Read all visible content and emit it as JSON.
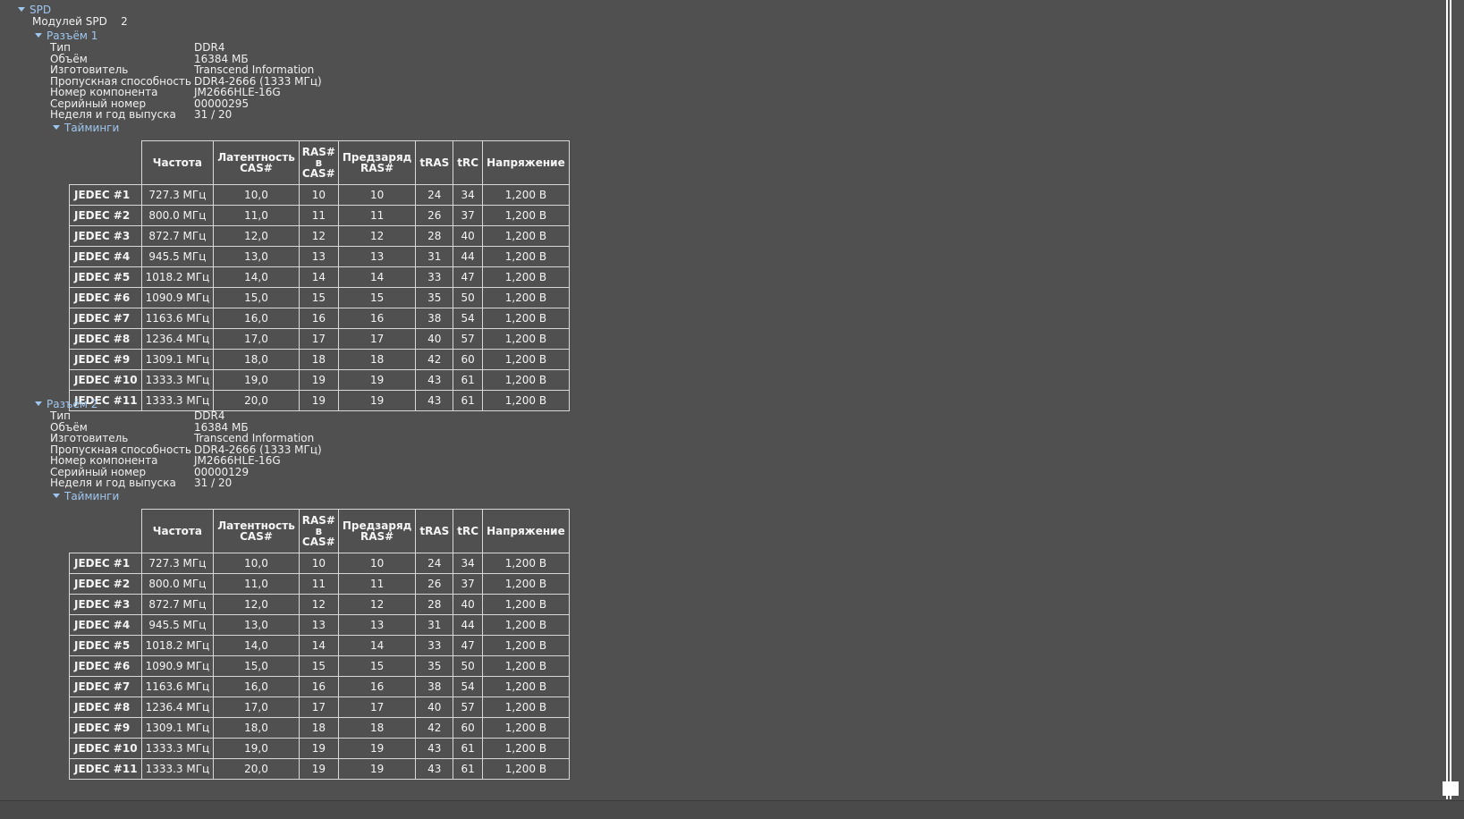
{
  "tree": {
    "root_label": "SPD",
    "modules_label": "Модулей SPD",
    "modules_count": "2",
    "timings_label": "Тайминги"
  },
  "slots": [
    {
      "label": "Разъём 1",
      "props": [
        {
          "label": "Тип",
          "value": "DDR4"
        },
        {
          "label": "Объём",
          "value": "16384 МБ"
        },
        {
          "label": "Изготовитель",
          "value": "Transcend Information"
        },
        {
          "label": "Пропускная способность",
          "value": "DDR4-2666 (1333 МГц)"
        },
        {
          "label": "Номер компонента",
          "value": "JM2666HLE-16G"
        },
        {
          "label": "Серийный номер",
          "value": "00000295"
        },
        {
          "label": "Неделя и год выпуска",
          "value": "31 / 20"
        }
      ]
    },
    {
      "label": "Разъём 2",
      "props": [
        {
          "label": "Тип",
          "value": "DDR4"
        },
        {
          "label": "Объём",
          "value": "16384 МБ"
        },
        {
          "label": "Изготовитель",
          "value": "Transcend Information"
        },
        {
          "label": "Пропускная способность",
          "value": "DDR4-2666 (1333 МГц)"
        },
        {
          "label": "Номер компонента",
          "value": "JM2666HLE-16G"
        },
        {
          "label": "Серийный номер",
          "value": "00000129"
        },
        {
          "label": "Неделя и год выпуска",
          "value": "31 / 20"
        }
      ]
    }
  ],
  "timings_table": {
    "headers": [
      "Частота",
      "Латентность CAS#",
      "RAS# в CAS#",
      "Предзаряд RAS#",
      "tRAS",
      "tRC",
      "Напряжение"
    ],
    "rows": [
      [
        "JEDEC #1",
        "727.3 МГц",
        "10,0",
        "10",
        "10",
        "24",
        "34",
        "1,200 В"
      ],
      [
        "JEDEC #2",
        "800.0 МГц",
        "11,0",
        "11",
        "11",
        "26",
        "37",
        "1,200 В"
      ],
      [
        "JEDEC #3",
        "872.7 МГц",
        "12,0",
        "12",
        "12",
        "28",
        "40",
        "1,200 В"
      ],
      [
        "JEDEC #4",
        "945.5 МГц",
        "13,0",
        "13",
        "13",
        "31",
        "44",
        "1,200 В"
      ],
      [
        "JEDEC #5",
        "1018.2 МГц",
        "14,0",
        "14",
        "14",
        "33",
        "47",
        "1,200 В"
      ],
      [
        "JEDEC #6",
        "1090.9 МГц",
        "15,0",
        "15",
        "15",
        "35",
        "50",
        "1,200 В"
      ],
      [
        "JEDEC #7",
        "1163.6 МГц",
        "16,0",
        "16",
        "16",
        "38",
        "54",
        "1,200 В"
      ],
      [
        "JEDEC #8",
        "1236.4 МГц",
        "17,0",
        "17",
        "17",
        "40",
        "57",
        "1,200 В"
      ],
      [
        "JEDEC #9",
        "1309.1 МГц",
        "18,0",
        "18",
        "18",
        "42",
        "60",
        "1,200 В"
      ],
      [
        "JEDEC #10",
        "1333.3 МГц",
        "19,0",
        "19",
        "19",
        "43",
        "61",
        "1,200 В"
      ],
      [
        "JEDEC #11",
        "1333.3 МГц",
        "20,0",
        "19",
        "19",
        "43",
        "61",
        "1,200 В"
      ]
    ]
  }
}
